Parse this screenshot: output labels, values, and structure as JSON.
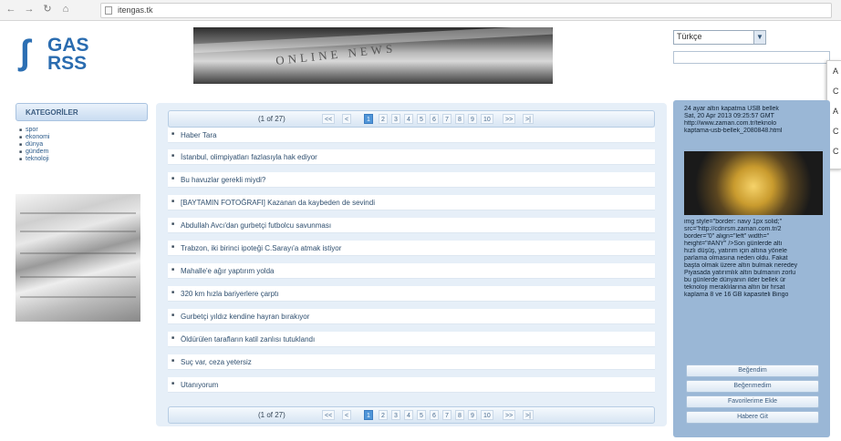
{
  "browser": {
    "url": "itengas.tk"
  },
  "logo": {
    "line1": "GAS",
    "line2": "RSS"
  },
  "banner": {
    "text": "ONLINE NEWS"
  },
  "language": {
    "selected": "Türkçe"
  },
  "popup_items": [
    "A",
    "C",
    "A",
    "C",
    "C"
  ],
  "categories": {
    "title": "KATEGORİLER",
    "items": [
      "spor",
      "ekonomi",
      "dünya",
      "gündem",
      "teknoloji"
    ]
  },
  "pager": {
    "label": "(1 of 27)",
    "first": "<<",
    "prev": "<",
    "pages": [
      "1",
      "2",
      "3",
      "4",
      "5",
      "6",
      "7",
      "8",
      "9",
      "10"
    ],
    "next": ">>",
    "last": ">|"
  },
  "news": [
    "Haber Tara",
    "İstanbul, olimpiyatları fazlasıyla hak ediyor",
    "Bu havuzlar gerekli miydi?",
    "[BAYTAMIN FOTOĞRAFI] Kazanan da kaybeden de sevindi",
    "Abdullah Avcı'dan gurbetçi futbolcu savunması",
    "Trabzon, iki birinci ipoteği C.Sarayı'a atmak istiyor",
    "Mahalle'e ağır yaptırım yolda",
    "320 km hızla bariyerlere çarptı",
    "Gurbetçi yıldız kendine hayran bırakıyor",
    "Öldürülen tarafların katil zanlısı tutuklandı",
    "Suç var, ceza yetersiz",
    "Utanıyorum"
  ],
  "right_panel": {
    "top_lines": [
      "24 ayar altın kapatma USB bellek",
      "Sat, 20 Apr 2013 09:25:57 GMT",
      "http://www.zaman.com.tr/teknolo",
      "kaptama-usb-bellek_2080848.html"
    ],
    "body_lines": [
      "img style=\"border: navy 1px solid;\"",
      "src=\"http://cdnrsm.zaman.com.tr/2",
      "border=\"0\" align=\"left\" width=\"",
      "height=\"#ANY\" />Son günlerde altı",
      "hızlı düşüş, yatırım için altına yönele",
      "parlama olmasına neden oldu. Fakat",
      "başta olmak üzere altın bulmak neredey",
      "Piyasada yatırımlık altın bulmanın zorlu",
      "bu günlerde dünyanın ilder bellek ür",
      "teknoloji meraklılarına altın bir fırsat",
      "kaplama 8 ve 16 GB kapasiteli Bingo"
    ],
    "buttons": [
      "Beğendim",
      "Beğenmedim",
      "Favorilerime Ekle",
      "Habere Git"
    ]
  }
}
